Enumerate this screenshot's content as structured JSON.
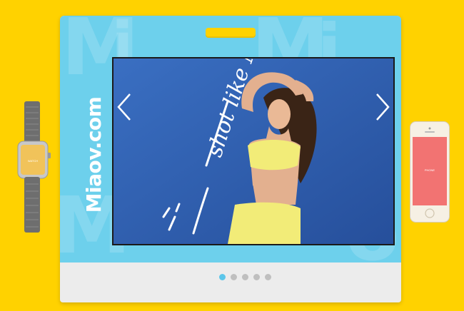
{
  "brand": {
    "text": "Miaov.com"
  },
  "slide": {
    "caption": "shot like Miranda"
  },
  "slider": {
    "prev_icon": "chevron-left-icon",
    "next_icon": "chevron-right-icon",
    "total_dots": 5,
    "active_dot": 1
  },
  "colors": {
    "background": "#ffd200",
    "frame_top": "#6dd0ec",
    "photo_bg": "#2f62b7",
    "dot_active": "#5cc6ea",
    "dot_inactive": "#bfbfbf",
    "phone_screen": "#f27372"
  }
}
